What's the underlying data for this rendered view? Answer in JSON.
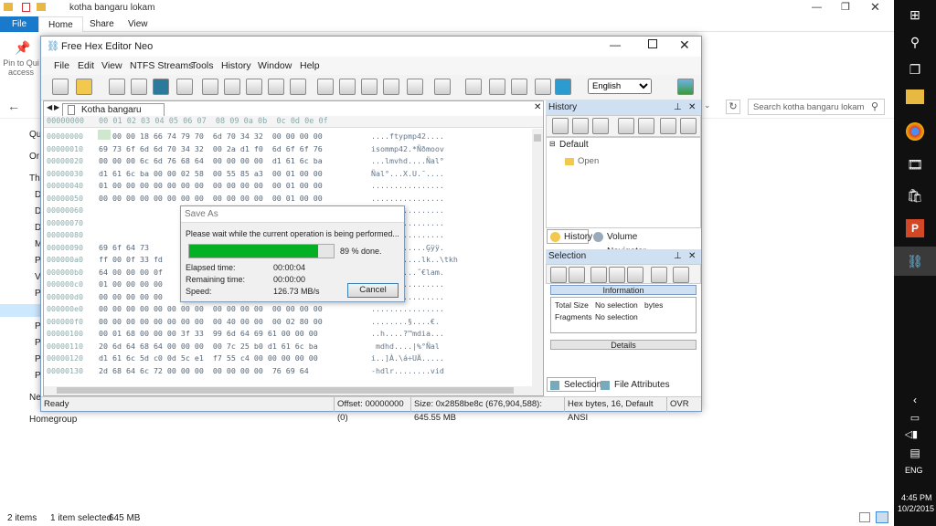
{
  "explorer": {
    "title": "kotha bangaru lokam",
    "tabs": [
      "File",
      "Home",
      "Share",
      "View"
    ],
    "pin_label_1": "Pin to Qui",
    "pin_label_2": "access",
    "search_placeholder": "Search kotha bangaru lokam",
    "side_items": [
      "Qu",
      "Or",
      "Th",
      "D",
      "D",
      "D",
      "M",
      "P",
      "V",
      "P",
      "P",
      "P",
      "P",
      "P",
      "P",
      "P",
      "Ne",
      "Homegroup"
    ],
    "status_items": "2 items",
    "status_selected": "1 item selected",
    "status_size": "645 MB"
  },
  "hex": {
    "title": "Free Hex Editor Neo",
    "menu": [
      "File",
      "Edit",
      "View",
      "NTFS Streams",
      "Tools",
      "History",
      "Window",
      "Help"
    ],
    "language": "English",
    "doc_tab": "Kotha bangaru lokam",
    "header_offset": "00000000",
    "header_cols": "00 01 02 03 04 05 06 07  08 09 0a 0b  0c 0d 0e 0f",
    "rows": [
      {
        "off": "00000000",
        "bytes": "00 00 00 18 66 74 79 70  6d 70 34 32  00 00 00 00",
        "ascii": "....ftypmp42...."
      },
      {
        "off": "00000010",
        "bytes": "69 73 6f 6d 6d 70 34 32  00 2a d1 f0  6d 6f 6f 76",
        "ascii": "isommp42.*Ñðmoov"
      },
      {
        "off": "00000020",
        "bytes": "00 00 00 6c 6d 76 68 64  00 00 00 00  d1 61 6c ba",
        "ascii": "...lmvhd....Ñal°"
      },
      {
        "off": "00000030",
        "bytes": "d1 61 6c ba 00 00 02 58  00 55 85 a3  00 01 00 00",
        "ascii": "Ñal°...X.U.¯...."
      },
      {
        "off": "00000040",
        "bytes": "01 00 00 00 00 00 00 00  00 00 00 00  00 01 00 00",
        "ascii": "................"
      },
      {
        "off": "00000050",
        "bytes": "00 00 00 00 00 00 00 00  00 00 00 00  00 01 00 00",
        "ascii": "................"
      },
      {
        "off": "00000060",
        "bytes": "",
        "ascii": "................"
      },
      {
        "off": "00000070",
        "bytes": "",
        "ascii": "................"
      },
      {
        "off": "00000080",
        "bytes": "",
        "ascii": "................"
      },
      {
        "off": "00000090",
        "bytes": "69 6f 64 73",
        "ascii": "............Ģÿÿ."
      },
      {
        "off": "000000a0",
        "bytes": "ff 00 0f 33 fd",
        "ascii": "...........lk..\\tkh"
      },
      {
        "off": "000000b0",
        "bytes": "64 00 00 00 0f",
        "ascii": "..........˝€lam."
      },
      {
        "off": "000000c0",
        "bytes": "01 00 00 00 00",
        "ascii": "................"
      },
      {
        "off": "000000d0",
        "bytes": "00 00 00 00 00",
        "ascii": "................"
      },
      {
        "off": "000000e0",
        "bytes": "00 00 00 00 00 00 00 00  00 00 00 00  00 00 00 00",
        "ascii": "................"
      },
      {
        "off": "000000f0",
        "bytes": "00 00 00 00 00 00 00 00  00 40 00 00  00 02 80 00",
        "ascii": "........§....€."
      },
      {
        "off": "00000100",
        "bytes": "00 01 68 00 00 00 3f 33  99 6d 64 69 61 00 00 00",
        "ascii": "..h....?™mdia..."
      },
      {
        "off": "00000110",
        "bytes": "20 6d 64 68 64 00 00 00  00 7c 25 b0 d1 61 6c ba",
        "ascii": " mdhd....|%°Ñal"
      },
      {
        "off": "00000120",
        "bytes": "d1 61 6c 5d c0 0d 5c e1  f7 55 c4 00 00 00 00 00",
        "ascii": "i..]À.\\á÷UÄ....."
      },
      {
        "off": "00000130",
        "bytes": "2d 68 64 6c 72 00 00 00  00 00 00 00  76 69 64",
        "ascii": "-hdlr........vid"
      }
    ],
    "history_title": "History",
    "history_root": "Default",
    "history_item": "Open",
    "tab_history": "History",
    "tab_volume": "Volume Navigator",
    "selection_title": "Selection",
    "information": "Information",
    "info_rows": [
      {
        "k": "Total Size",
        "v": "No selection",
        "u": "bytes"
      },
      {
        "k": "Fragments",
        "v": "No selection",
        "u": ""
      }
    ],
    "details": "Details",
    "tab_selection": "Selection",
    "tab_file_attr": "File Attributes",
    "status": {
      "ready": "Ready",
      "offset": "Offset: 00000000 (0)",
      "size": "Size: 0x2858be8c (676,904,588): 645.55 MB",
      "mode": "Hex bytes, 16, Default ANSI",
      "ovr": "OVR"
    }
  },
  "dialog": {
    "title": "Save As",
    "message": "Please wait while the current operation is being performed...",
    "progress": 0.89,
    "progress_text": "89 % done.",
    "elapsed_label": "Elapsed time:",
    "elapsed": "00:00:04",
    "remaining_label": "Remaining time:",
    "remaining": "00:00:00",
    "speed_label": "Speed:",
    "speed": "126.73 MB/s",
    "cancel": "Cancel"
  },
  "taskbar": {
    "lang": "ENG",
    "time": "4:45 PM",
    "date": "10/2/2015"
  }
}
